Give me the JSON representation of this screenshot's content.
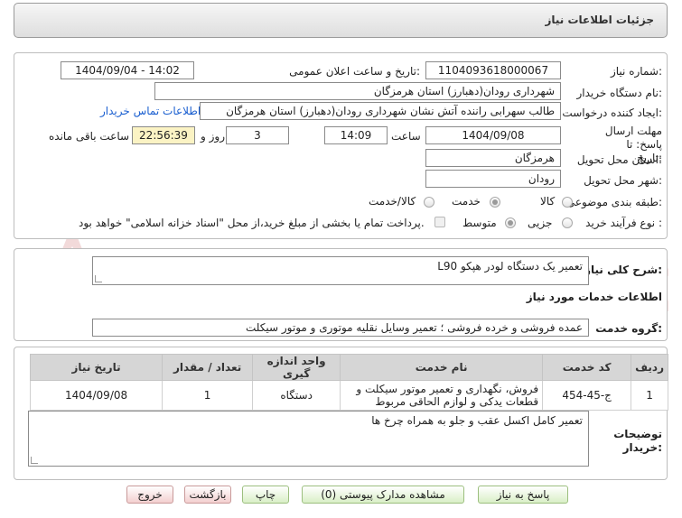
{
  "header": {
    "title": "جزئیات اطلاعات نیاز"
  },
  "form": {
    "need_number_label": "شماره نیاز:",
    "need_number": "1104093618000067",
    "announce_label": "تاریخ و ساعت اعلان عمومی:",
    "announce_value": "1404/09/04 - 14:02",
    "buyer_org_label": "نام دستگاه خریدار:",
    "buyer_org": "شهرداری رودان(دهبارز) استان هرمزگان",
    "requester_label": "ایجاد کننده درخواست:",
    "requester": "طالب سهرابی راننده آتش نشان شهرداری رودان(دهبارز) استان هرمزگان",
    "contact_link": "اطلاعات تماس خریدار",
    "deadline_label": "مهلت ارسال پاسخ: تا تاریخ:",
    "deadline_date": "1404/09/08",
    "time_label": "ساعت",
    "deadline_time": "14:09",
    "days_value": "3",
    "days_label": "روز و",
    "remaining_time": "22:56:39",
    "remaining_label": "ساعت باقی مانده",
    "province_label": "استان محل تحویل:",
    "province": "هرمزگان",
    "city_label": "شهر محل تحویل:",
    "city": "رودان",
    "category_label": "طبقه بندی موضوعی:",
    "category_options": [
      "کالا",
      "خدمت",
      "کالا/خدمت"
    ],
    "process_label": "نوع فرآیند خرید :",
    "process_options": [
      "جزیی",
      "متوسط"
    ],
    "payment_note": "پرداخت تمام یا بخشی از مبلغ خرید،از محل \"اسناد خزانه اسلامی\" خواهد بود."
  },
  "summary": {
    "label": "شرح کلی نیاز:",
    "value": "تعمیر یک دستگاه لودر هپکو L90"
  },
  "services": {
    "section_title": "اطلاعات خدمات مورد نیاز",
    "group_label": "گروه خدمت:",
    "group_value": "عمده فروشی و خرده فروشی ؛ تعمیر وسایل نقلیه موتوری و موتور سیکلت"
  },
  "table": {
    "headers": [
      "ردیف",
      "کد خدمت",
      "نام خدمت",
      "واحد اندازه گیری",
      "تعداد / مقدار",
      "تاریخ نیاز"
    ],
    "rows": [
      [
        "1",
        "ج-45-454",
        "فروش، نگهداری و تعمیر موتور سیکلت و قطعات یدکی و لوازم الحاقی مربوط",
        "دستگاه",
        "1",
        "1404/09/08"
      ]
    ]
  },
  "description": {
    "label": "توضیحات خریدار:",
    "value": "تعمیر کامل اکسل عقب و جلو به همراه چرخ ها"
  },
  "watermark": {
    "text": "AriaTender.net"
  },
  "buttons": {
    "respond": "پاسخ به نیاز",
    "view_docs": "مشاهده مدارک پیوستی (0)",
    "print": "چاپ",
    "back": "بازگشت",
    "exit": "خروج"
  },
  "colors": {
    "link": "#1a5fd0",
    "timer_bg": "#fbf3c4",
    "header_bg": "#dedede",
    "table_header_bg": "#d6d6d6",
    "watermark": "#e9bcbc"
  }
}
